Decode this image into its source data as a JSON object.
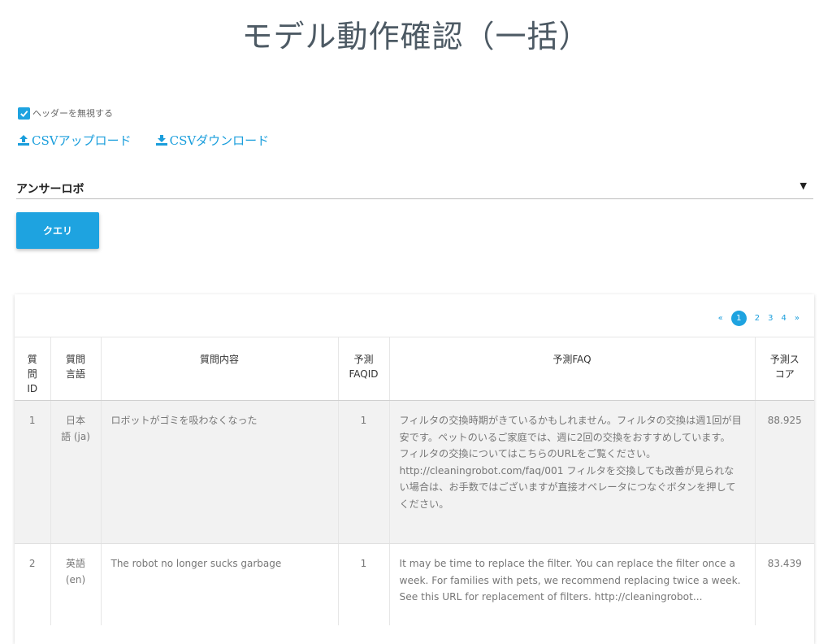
{
  "page": {
    "title": "モデル動作確認（一括）"
  },
  "options": {
    "ignore_header_label": "ヘッダーを無視する",
    "ignore_header_checked": true
  },
  "actions": {
    "csv_upload": "CSVアップロード",
    "csv_download": "CSVダウンロード",
    "query_button": "クエリ"
  },
  "model_select": {
    "selected": "アンサーロボ"
  },
  "pagination": {
    "prev": "«",
    "pages": [
      "1",
      "2",
      "3",
      "4"
    ],
    "current": "1",
    "next": "»"
  },
  "table": {
    "headers": {
      "question_id": "質\n問\nID",
      "question_lang": "質問\n言語",
      "question_text": "質問内容",
      "predicted_faqid": "予測\nFAQID",
      "predicted_faq": "予測FAQ",
      "predicted_score": "予測ス\nコア"
    },
    "rows": [
      {
        "id": "1",
        "lang": "日本\n語 (ja)",
        "question": "ロボットがゴミを吸わなくなった",
        "faqid": "1",
        "faq": "フィルタの交換時期がきているかもしれません。フィルタの交換は週1回が目安です。ペットのいるご家庭では、週に2回の交換をおすすめしています。 フィルタの交換についてはこちらのURLをご覧ください。 http://cleaningrobot.com/faq/001 フィルタを交換しても改善が見られない場合は、お手数ではございますが直接オペレータにつなぐボタンを押してください。",
        "score": "88.925"
      },
      {
        "id": "2",
        "lang": "英語\n(en)",
        "question": "The robot no longer sucks garbage",
        "faqid": "1",
        "faq": "It may be time to replace the filter. You can replace the filter once a week. For families with pets, we recommend replacing twice a week. See this URL for replacement of filters. http://cleaningrobot...",
        "score": "83.439"
      }
    ]
  },
  "colors": {
    "accent": "#1ea3e0",
    "title": "#4d5a64"
  }
}
